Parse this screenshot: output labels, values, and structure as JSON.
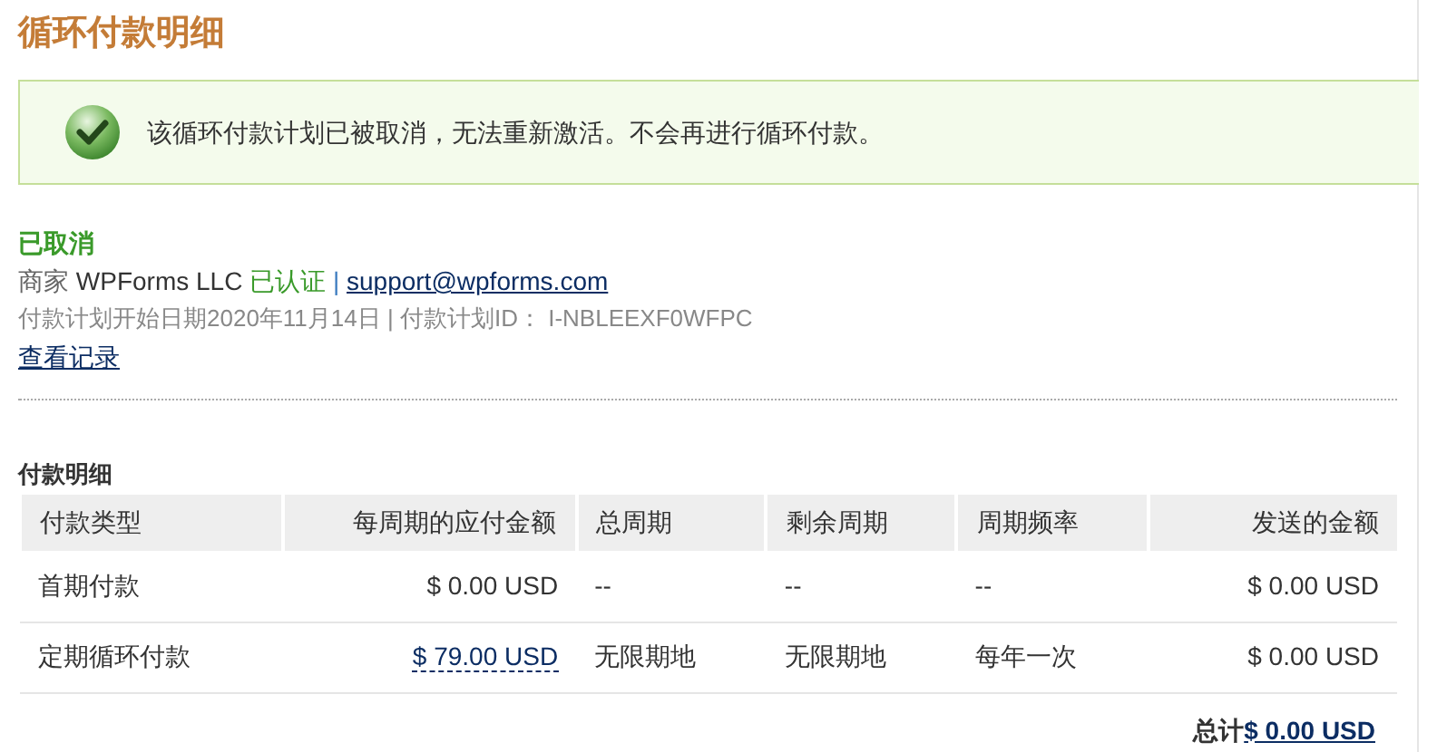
{
  "title": "循环付款明细",
  "notice": {
    "text": "该循环付款计划已被取消，无法重新激活。不会再进行循环付款。"
  },
  "status": {
    "label": "已取消"
  },
  "merchant": {
    "prefix": "商家",
    "name": "WPForms LLC",
    "verified": "已认证",
    "separator": "|",
    "email": "support@wpforms.com"
  },
  "plan_info": "付款计划开始日期2020年11月14日 | 付款计划ID： I-NBLEEXF0WFPC",
  "history_link": "查看记录",
  "details": {
    "heading": "付款明细",
    "columns": [
      "付款类型",
      "每周期的应付金额",
      "总周期",
      "剩余周期",
      "周期频率",
      "发送的金额"
    ],
    "rows": [
      {
        "cells": [
          "首期付款",
          "$ 0.00 USD",
          "--",
          "--",
          "--",
          "$ 0.00 USD"
        ],
        "amount_link": false
      },
      {
        "cells": [
          "定期循环付款",
          "$ 79.00 USD",
          "无限期地",
          "无限期地",
          "每年一次",
          "$ 0.00 USD"
        ],
        "amount_link": true
      }
    ],
    "total": {
      "label": "总计",
      "value": "$ 0.00 USD"
    }
  }
}
